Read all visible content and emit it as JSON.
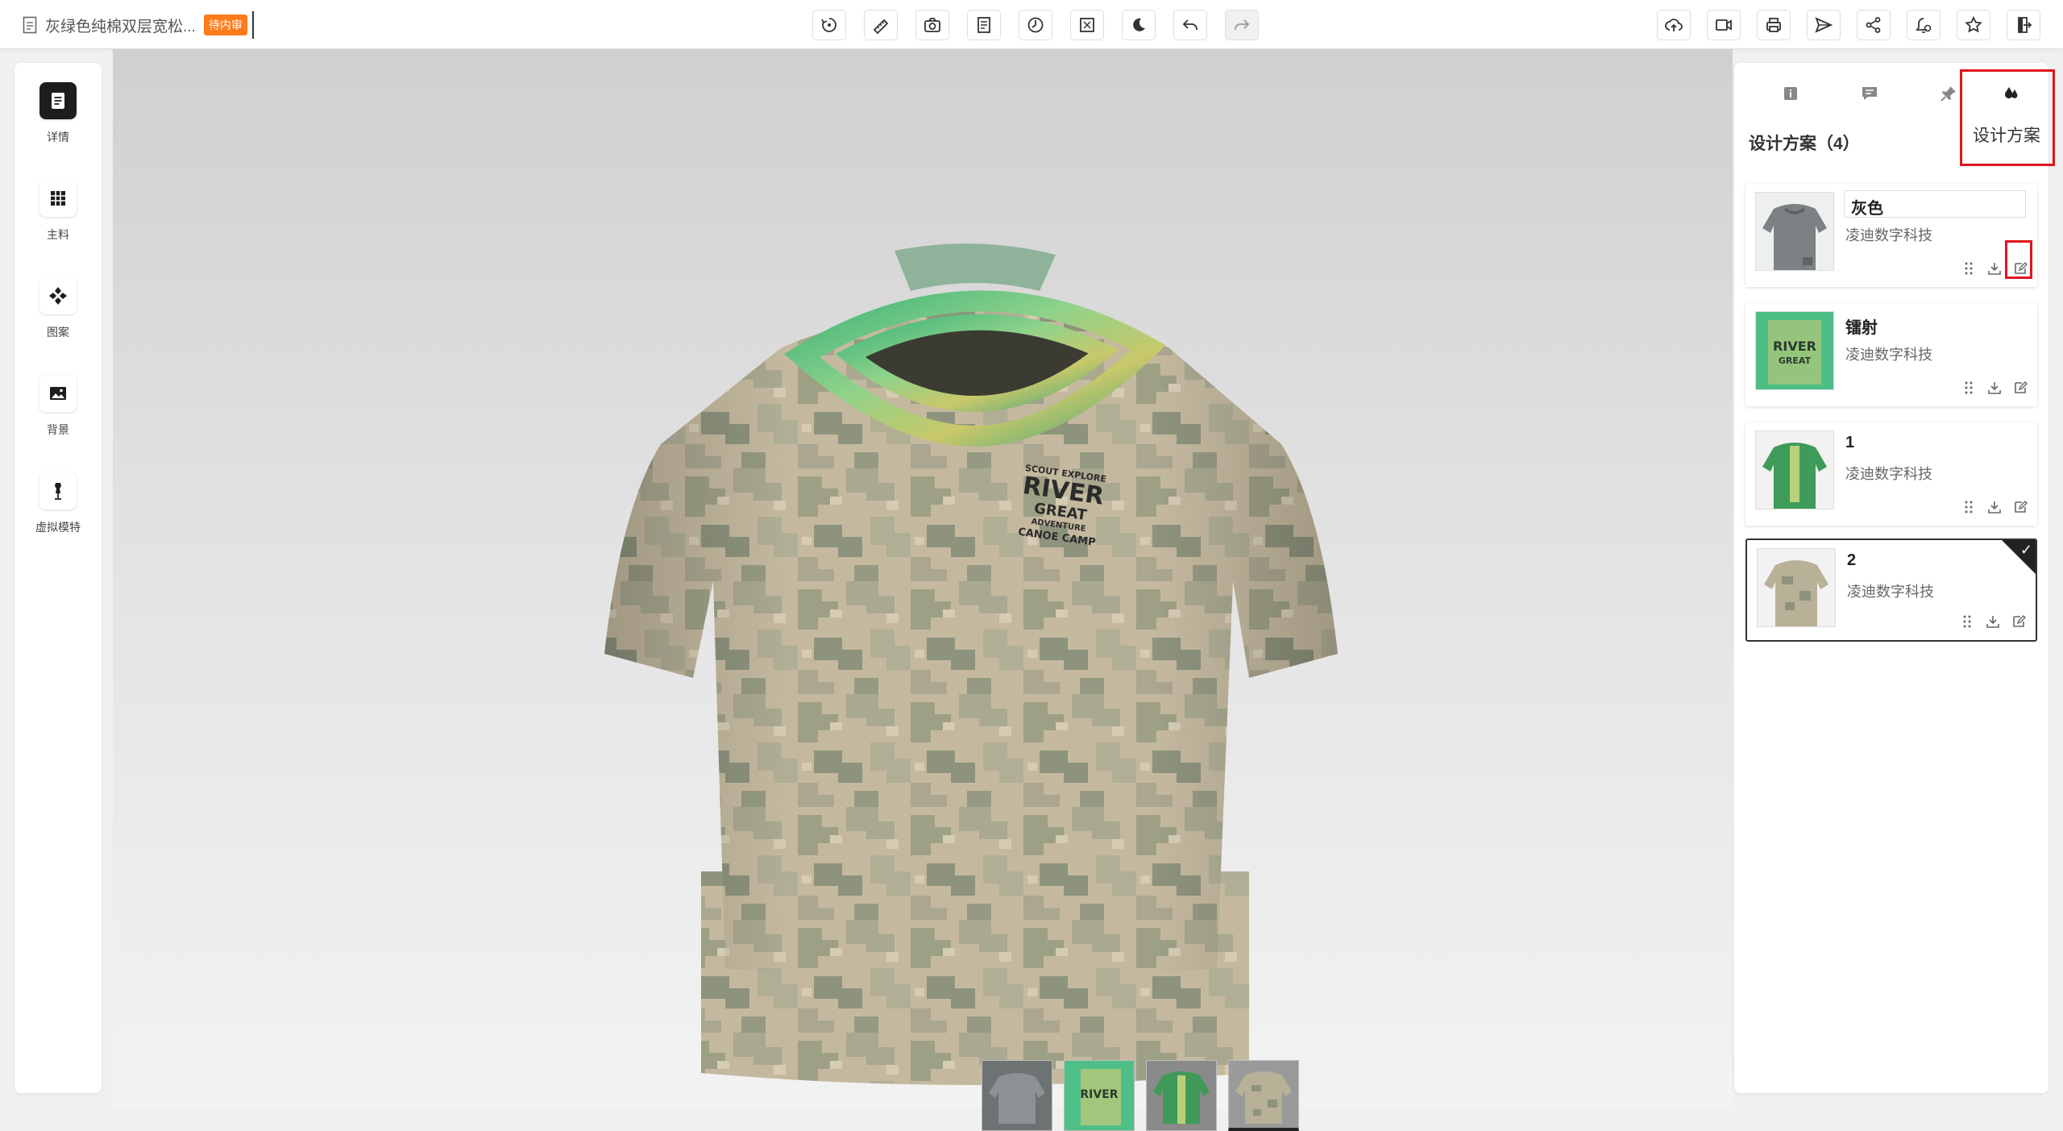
{
  "header": {
    "title": "灰绿色纯棉双层宽松...",
    "status_badge": "待内审"
  },
  "toolbar": {
    "center_tools": [
      "rotate-icon",
      "measure-icon",
      "camera-icon",
      "document-icon",
      "clock-icon",
      "fullscreen-icon",
      "night-mode-icon",
      "undo-icon",
      "redo-icon"
    ],
    "right_tools": [
      "cloud-upload-icon",
      "video-icon",
      "printer-icon",
      "send-icon",
      "share-icon",
      "alert-settings-icon",
      "star-icon",
      "exit-icon"
    ]
  },
  "sidebar": {
    "items": [
      {
        "label": "详情",
        "icon": "document-icon"
      },
      {
        "label": "主料",
        "icon": "grid-icon"
      },
      {
        "label": "图案",
        "icon": "pattern-icon"
      },
      {
        "label": "背景",
        "icon": "image-icon"
      },
      {
        "label": "虚拟模特",
        "icon": "mannequin-icon"
      }
    ]
  },
  "panel": {
    "tabs": [
      "info-icon",
      "comment-icon",
      "pin-icon",
      "drops-icon"
    ],
    "tooltip": "设计方案",
    "section_title": "设计方案（4）",
    "schemes": [
      {
        "name": "灰色",
        "owner": "凌迪数字科技",
        "editing": true
      },
      {
        "name": "镭射",
        "owner": "凌迪数字科技"
      },
      {
        "name": "1",
        "owner": "凌迪数字科技"
      },
      {
        "name": "2",
        "owner": "凌迪数字科技",
        "selected": true
      }
    ]
  },
  "garment": {
    "print_lines": [
      "SCOUT EXPLORE",
      "RIVER",
      "GREAT",
      "ADVENTURE",
      "CANOE CAMP"
    ]
  },
  "colors": {
    "accent_orange": "#ff7a1a",
    "highlight_red": "#e0141e",
    "dark": "#222222"
  }
}
